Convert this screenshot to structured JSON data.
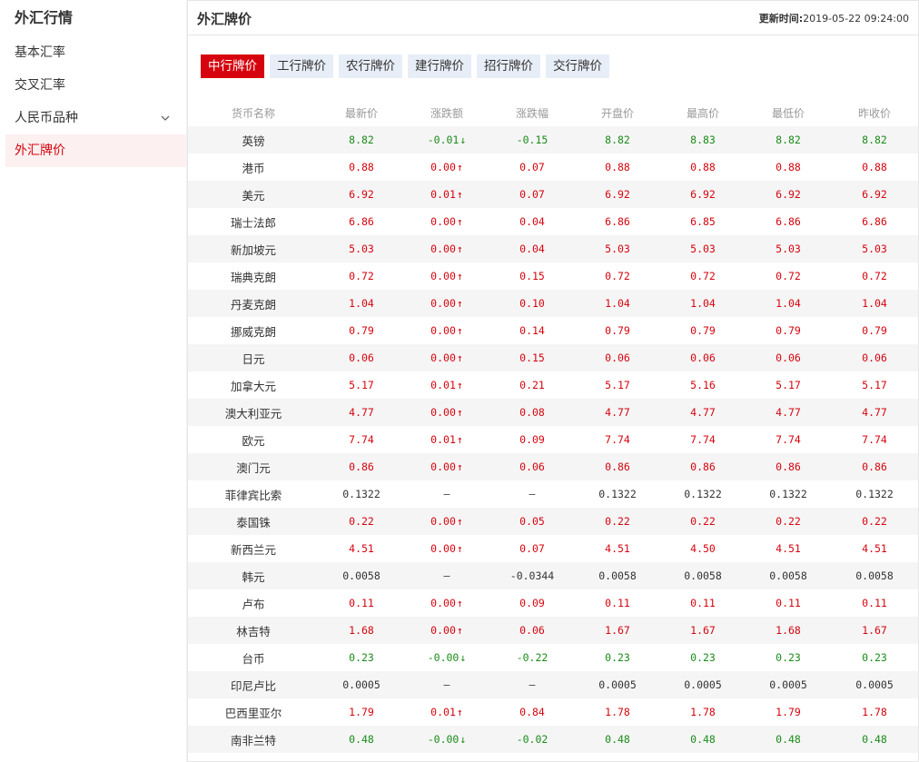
{
  "sidebar": {
    "title": "外汇行情",
    "items": [
      {
        "label": "基本汇率",
        "active": false
      },
      {
        "label": "交叉汇率",
        "active": false
      },
      {
        "label": "人民币品种",
        "active": false,
        "expandable": true
      },
      {
        "label": "外汇牌价",
        "active": true
      }
    ]
  },
  "main": {
    "title": "外汇牌价",
    "update_label": "更新时间:",
    "update_time": "2019-05-22 09:24:00",
    "tabs": [
      "中行牌价",
      "工行牌价",
      "农行牌价",
      "建行牌价",
      "招行牌价",
      "交行牌价"
    ],
    "active_tab": 0,
    "columns": [
      "货币名称",
      "最新价",
      "涨跌额",
      "涨跌幅",
      "开盘价",
      "最高价",
      "最低价",
      "昨收价"
    ],
    "rows": [
      {
        "name": "英镑",
        "trend": "down",
        "latest": "8.82",
        "change": "-0.01",
        "pct": "-0.15",
        "open": "8.82",
        "high": "8.83",
        "low": "8.82",
        "prev": "8.82"
      },
      {
        "name": "港币",
        "trend": "up",
        "latest": "0.88",
        "change": "0.00",
        "pct": "0.07",
        "open": "0.88",
        "high": "0.88",
        "low": "0.88",
        "prev": "0.88"
      },
      {
        "name": "美元",
        "trend": "up",
        "latest": "6.92",
        "change": "0.01",
        "pct": "0.07",
        "open": "6.92",
        "high": "6.92",
        "low": "6.92",
        "prev": "6.92"
      },
      {
        "name": "瑞士法郎",
        "trend": "up",
        "latest": "6.86",
        "change": "0.00",
        "pct": "0.04",
        "open": "6.86",
        "high": "6.85",
        "low": "6.86",
        "prev": "6.86"
      },
      {
        "name": "新加坡元",
        "trend": "up",
        "latest": "5.03",
        "change": "0.00",
        "pct": "0.04",
        "open": "5.03",
        "high": "5.03",
        "low": "5.03",
        "prev": "5.03"
      },
      {
        "name": "瑞典克朗",
        "trend": "up",
        "latest": "0.72",
        "change": "0.00",
        "pct": "0.15",
        "open": "0.72",
        "high": "0.72",
        "low": "0.72",
        "prev": "0.72"
      },
      {
        "name": "丹麦克朗",
        "trend": "up",
        "latest": "1.04",
        "change": "0.00",
        "pct": "0.10",
        "open": "1.04",
        "high": "1.04",
        "low": "1.04",
        "prev": "1.04"
      },
      {
        "name": "挪威克朗",
        "trend": "up",
        "latest": "0.79",
        "change": "0.00",
        "pct": "0.14",
        "open": "0.79",
        "high": "0.79",
        "low": "0.79",
        "prev": "0.79"
      },
      {
        "name": "日元",
        "trend": "up",
        "latest": "0.06",
        "change": "0.00",
        "pct": "0.15",
        "open": "0.06",
        "high": "0.06",
        "low": "0.06",
        "prev": "0.06"
      },
      {
        "name": "加拿大元",
        "trend": "up",
        "latest": "5.17",
        "change": "0.01",
        "pct": "0.21",
        "open": "5.17",
        "high": "5.16",
        "low": "5.17",
        "prev": "5.17"
      },
      {
        "name": "澳大利亚元",
        "trend": "up",
        "latest": "4.77",
        "change": "0.00",
        "pct": "0.08",
        "open": "4.77",
        "high": "4.77",
        "low": "4.77",
        "prev": "4.77"
      },
      {
        "name": "欧元",
        "trend": "up",
        "latest": "7.74",
        "change": "0.01",
        "pct": "0.09",
        "open": "7.74",
        "high": "7.74",
        "low": "7.74",
        "prev": "7.74"
      },
      {
        "name": "澳门元",
        "trend": "up",
        "latest": "0.86",
        "change": "0.00",
        "pct": "0.06",
        "open": "0.86",
        "high": "0.86",
        "low": "0.86",
        "prev": "0.86"
      },
      {
        "name": "菲律宾比索",
        "trend": "flat",
        "latest": "0.1322",
        "change": "—",
        "pct": "—",
        "open": "0.1322",
        "high": "0.1322",
        "low": "0.1322",
        "prev": "0.1322"
      },
      {
        "name": "泰国铢",
        "trend": "up",
        "latest": "0.22",
        "change": "0.00",
        "pct": "0.05",
        "open": "0.22",
        "high": "0.22",
        "low": "0.22",
        "prev": "0.22"
      },
      {
        "name": "新西兰元",
        "trend": "up",
        "latest": "4.51",
        "change": "0.00",
        "pct": "0.07",
        "open": "4.51",
        "high": "4.50",
        "low": "4.51",
        "prev": "4.51"
      },
      {
        "name": "韩元",
        "trend": "flat",
        "latest": "0.0058",
        "change": "—",
        "pct": "-0.0344",
        "open": "0.0058",
        "high": "0.0058",
        "low": "0.0058",
        "prev": "0.0058"
      },
      {
        "name": "卢布",
        "trend": "up",
        "latest": "0.11",
        "change": "0.00",
        "pct": "0.09",
        "open": "0.11",
        "high": "0.11",
        "low": "0.11",
        "prev": "0.11"
      },
      {
        "name": "林吉特",
        "trend": "up",
        "latest": "1.68",
        "change": "0.00",
        "pct": "0.06",
        "open": "1.67",
        "high": "1.67",
        "low": "1.68",
        "prev": "1.67"
      },
      {
        "name": "台币",
        "trend": "down",
        "latest": "0.23",
        "change": "-0.00",
        "pct": "-0.22",
        "open": "0.23",
        "high": "0.23",
        "low": "0.23",
        "prev": "0.23"
      },
      {
        "name": "印尼卢比",
        "trend": "flat",
        "latest": "0.0005",
        "change": "—",
        "pct": "—",
        "open": "0.0005",
        "high": "0.0005",
        "low": "0.0005",
        "prev": "0.0005"
      },
      {
        "name": "巴西里亚尔",
        "trend": "up",
        "latest": "1.79",
        "change": "0.01",
        "pct": "0.84",
        "open": "1.78",
        "high": "1.78",
        "low": "1.79",
        "prev": "1.78"
      },
      {
        "name": "南非兰特",
        "trend": "down",
        "latest": "0.48",
        "change": "-0.00",
        "pct": "-0.02",
        "open": "0.48",
        "high": "0.48",
        "low": "0.48",
        "prev": "0.48"
      }
    ]
  },
  "colors": {
    "up": "#d6040e",
    "down": "#1a8c1a",
    "accent": "#d6040e"
  },
  "icons": {
    "up": "arrow-up-icon",
    "down": "arrow-down-icon",
    "expand": "chevron-down-icon"
  }
}
